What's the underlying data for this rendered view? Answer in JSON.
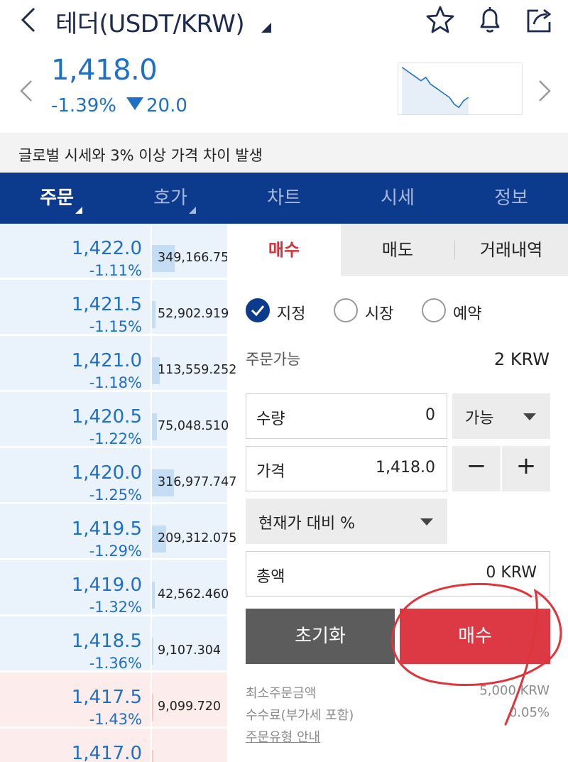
{
  "header": {
    "title": "테더(USDT/KRW)"
  },
  "ticker": {
    "price": "1,418.0",
    "change_pct": "-1.39%",
    "change_abs": "20.0",
    "sparkline": [
      1427,
      1426,
      1425,
      1424,
      1423,
      1424,
      1422,
      1421,
      1420,
      1419,
      1418,
      1416,
      1415,
      1417,
      1418
    ],
    "color": "#1e6fc8"
  },
  "notice": "글로벌 시세와 3% 이상 가격 차이 발생",
  "tabs": [
    {
      "label": "주문",
      "active": true
    },
    {
      "label": "호가",
      "active": false
    },
    {
      "label": "차트",
      "active": false
    },
    {
      "label": "시세",
      "active": false
    },
    {
      "label": "정보",
      "active": false
    }
  ],
  "orderbook": [
    {
      "price": "1,422.0",
      "pct": "-1.11%",
      "volume": "349,166.751",
      "vol_ratio": 0.3,
      "side": "ask"
    },
    {
      "price": "1,421.5",
      "pct": "-1.15%",
      "volume": "52,902.919",
      "vol_ratio": 0.05,
      "side": "ask"
    },
    {
      "price": "1,421.0",
      "pct": "-1.18%",
      "volume": "113,559.252",
      "vol_ratio": 0.1,
      "side": "ask"
    },
    {
      "price": "1,420.5",
      "pct": "-1.22%",
      "volume": "75,048.510",
      "vol_ratio": 0.07,
      "side": "ask"
    },
    {
      "price": "1,420.0",
      "pct": "-1.25%",
      "volume": "316,977.747",
      "vol_ratio": 0.29,
      "side": "ask"
    },
    {
      "price": "1,419.5",
      "pct": "-1.29%",
      "volume": "209,312.075",
      "vol_ratio": 0.19,
      "side": "ask"
    },
    {
      "price": "1,419.0",
      "pct": "-1.32%",
      "volume": "42,562.460",
      "vol_ratio": 0.04,
      "side": "ask"
    },
    {
      "price": "1,418.5",
      "pct": "-1.36%",
      "volume": "9,107.304",
      "vol_ratio": 0.01,
      "side": "ask"
    },
    {
      "price": "1,417.5",
      "pct": "-1.43%",
      "volume": "9,099.720",
      "vol_ratio": 0.01,
      "side": "bid"
    },
    {
      "price": "1,417.0",
      "pct": "",
      "volume": "",
      "vol_ratio": 0.0,
      "side": "bid"
    }
  ],
  "order": {
    "tabs": [
      "매수",
      "매도",
      "거래내역"
    ],
    "types": [
      "지정",
      "시장",
      "예약"
    ],
    "available_label": "주문가능",
    "available_value": "2 KRW",
    "qty_label": "수량",
    "qty_value": "0",
    "qty_option": "가능",
    "price_label": "가격",
    "price_value": "1,418.0",
    "minus": "−",
    "plus": "+",
    "pct_select": "현재가 대비 %",
    "total_label": "총액",
    "total_value": "0 KRW",
    "reset_label": "초기화",
    "buy_label": "매수",
    "min_order_label": "최소주문금액",
    "min_order_value": "5,000 KRW",
    "fee_label": "수수료(부가세 포함)",
    "fee_value": "0.05%",
    "guide_link": "주문유형 안내"
  },
  "colors": {
    "navy": "#0c3a8c",
    "buy_red": "#dd3944",
    "price_blue": "#1e6fc8"
  },
  "icons": [
    "back-icon",
    "caret-icon",
    "star-icon",
    "bell-icon",
    "share-icon",
    "chevron-left-icon",
    "chevron-right-icon",
    "checkmark-icon",
    "dropdown-icon"
  ]
}
